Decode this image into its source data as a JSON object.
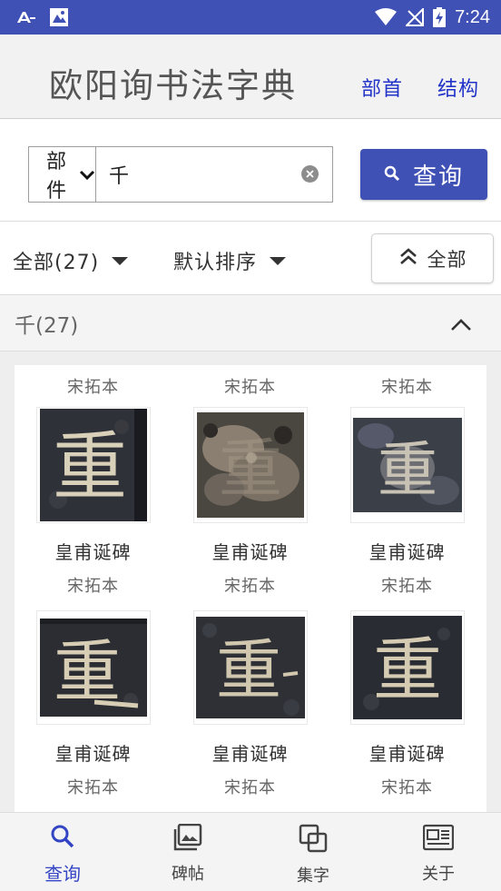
{
  "status_bar": {
    "time": "7:24",
    "icons": [
      "app-notification-icon",
      "gallery-notification-icon",
      "wifi-icon",
      "no-signal-icon",
      "battery-charging-icon"
    ]
  },
  "app_bar": {
    "title": "欧阳询书法字典",
    "links": [
      "部首",
      "结构"
    ]
  },
  "search": {
    "type_selected": "部件",
    "query": "千",
    "button_label": "查询",
    "accent": "#3f51b5"
  },
  "filters": {
    "all_label": "全部(27)",
    "sort_label": "默认排序",
    "collapse_label": "全部"
  },
  "group": {
    "title": "千(27)"
  },
  "top_versions": [
    "宋拓本",
    "宋拓本",
    "宋拓本"
  ],
  "rows": [
    {
      "items": [
        {
          "name": "皇甫诞碑",
          "version": "宋拓本",
          "char": "重"
        },
        {
          "name": "皇甫诞碑",
          "version": "宋拓本",
          "char": "重"
        },
        {
          "name": "皇甫诞碑",
          "version": "宋拓本",
          "char": "重"
        }
      ]
    },
    {
      "items": [
        {
          "name": "皇甫诞碑",
          "version": "宋拓本",
          "char": "重"
        },
        {
          "name": "皇甫诞碑",
          "version": "宋拓本",
          "char": "重"
        },
        {
          "name": "皇甫诞碑",
          "version": "宋拓本",
          "char": "重"
        }
      ]
    }
  ],
  "bottom_nav": {
    "items": [
      {
        "label": "查询",
        "icon": "search-icon",
        "active": true
      },
      {
        "label": "碑帖",
        "icon": "gallery-icon",
        "active": false
      },
      {
        "label": "集字",
        "icon": "collection-icon",
        "active": false
      },
      {
        "label": "关于",
        "icon": "about-icon",
        "active": false
      }
    ]
  }
}
